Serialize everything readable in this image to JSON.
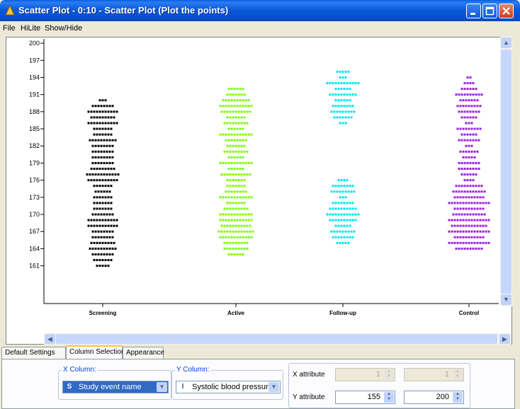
{
  "window": {
    "title": "Scatter Plot - 0:10 - Scatter Plot (Plot the points)"
  },
  "menu": [
    "File",
    "HiLite",
    "Show/Hide"
  ],
  "colors": {
    "screening": "#000000",
    "active": "#7cfc00",
    "followup": "#00e5ee",
    "control": "#9b1de6"
  },
  "chart_data": {
    "type": "scatter",
    "categories": [
      "Screening",
      "Active",
      "Follow-up",
      "Control"
    ],
    "ylim": [
      155,
      200
    ],
    "yticks": [
      161,
      164,
      167,
      170,
      173,
      176,
      179,
      182,
      185,
      188,
      191,
      194,
      197,
      200
    ],
    "ytick_labels": [
      "161",
      "164",
      "167",
      "170",
      "173",
      "176",
      "179",
      "182",
      "185",
      "188",
      "191",
      "194",
      "197",
      "200"
    ],
    "series": [
      {
        "category": "Screening",
        "color": "#000000",
        "y": [
          161,
          162,
          163,
          164,
          165,
          166,
          167,
          168,
          169,
          170,
          171,
          172,
          173,
          174,
          175,
          176,
          177,
          178,
          179,
          180,
          181,
          182,
          183,
          184,
          185,
          186,
          187,
          188,
          189,
          190
        ],
        "counts": [
          5,
          7,
          8,
          10,
          9,
          8,
          8,
          11,
          11,
          8,
          7,
          7,
          7,
          6,
          7,
          11,
          12,
          9,
          8,
          8,
          8,
          8,
          10,
          7,
          7,
          11,
          9,
          11,
          8,
          3
        ]
      },
      {
        "category": "Active",
        "color": "#7cfc00",
        "y": [
          163,
          164,
          165,
          166,
          167,
          168,
          169,
          170,
          171,
          172,
          173,
          174,
          175,
          176,
          177,
          178,
          179,
          180,
          181,
          182,
          183,
          184,
          185,
          186,
          187,
          188,
          189,
          190,
          191,
          192
        ],
        "counts": [
          6,
          9,
          9,
          12,
          13,
          11,
          12,
          12,
          9,
          7,
          12,
          8,
          7,
          7,
          11,
          6,
          12,
          6,
          9,
          7,
          8,
          12,
          6,
          9,
          7,
          11,
          12,
          10,
          7,
          6
        ]
      },
      {
        "category": "Follow-up",
        "color": "#00e5ee",
        "y": [
          165,
          166,
          167,
          168,
          169,
          170,
          171,
          172,
          173,
          174,
          175,
          176,
          186,
          187,
          188,
          189,
          190,
          191,
          192,
          193,
          194,
          195
        ],
        "counts": [
          5,
          8,
          9,
          6,
          10,
          12,
          10,
          8,
          3,
          9,
          8,
          4,
          3,
          7,
          9,
          8,
          6,
          10,
          6,
          12,
          3,
          5
        ]
      },
      {
        "category": "Control",
        "color": "#9b1de6",
        "y": [
          164,
          165,
          166,
          167,
          168,
          169,
          170,
          171,
          172,
          173,
          174,
          175,
          176,
          177,
          178,
          179,
          180,
          181,
          182,
          183,
          184,
          185,
          186,
          187,
          188,
          189,
          190,
          191,
          192,
          193,
          194
        ],
        "counts": [
          10,
          15,
          11,
          15,
          13,
          15,
          12,
          11,
          15,
          11,
          12,
          10,
          4,
          6,
          8,
          8,
          5,
          7,
          3,
          8,
          6,
          9,
          3,
          6,
          8,
          9,
          7,
          10,
          6,
          4,
          2
        ]
      }
    ]
  },
  "tabs": [
    "Default Settings",
    "Column Selection",
    "Appearance"
  ],
  "x_column": {
    "label": "X Column:",
    "type_icon": "S",
    "value": "Study event name"
  },
  "y_column": {
    "label": "Y Column:",
    "type_icon": "I",
    "value": "Systolic blood pressure"
  },
  "x_attribute": {
    "label": "X attribute",
    "min": "1",
    "max": "1"
  },
  "y_attribute": {
    "label": "Y attribute",
    "min": "155",
    "max": "200"
  }
}
